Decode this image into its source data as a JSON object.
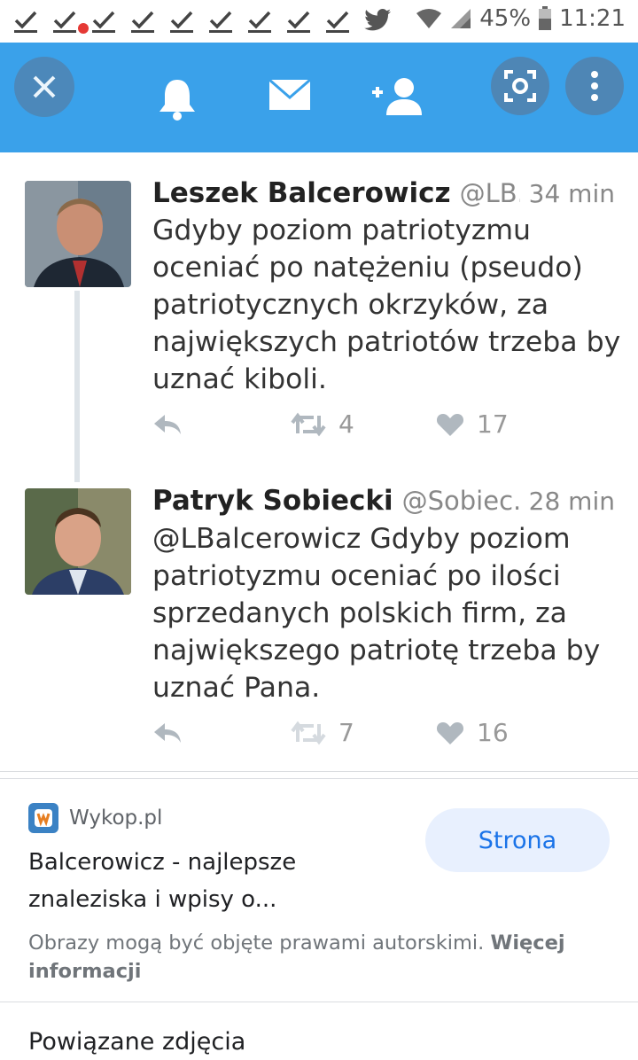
{
  "status_bar": {
    "battery_percent": "45%",
    "time": "11:21",
    "notification_icons": [
      "check-icon",
      "check-icon",
      "check-icon",
      "check-icon",
      "check-icon",
      "check-icon",
      "check-icon",
      "check-icon",
      "check-icon",
      "twitter-icon"
    ]
  },
  "toolbar": {
    "icons": [
      "close-icon",
      "notifications-bell-icon",
      "messages-envelope-icon",
      "add-user-icon",
      "lens-search-icon",
      "more-vert-icon"
    ],
    "background": "#3aa1ea"
  },
  "tweets": [
    {
      "name": "Leszek Balcerowicz",
      "handle": "@LB...",
      "time": "34 min",
      "text": "Gdyby poziom patriotyzmu oceniać po natężeniu (pseudo) patriotycznych okrzyków, za największych patriotów trzeba by uznać kiboli.",
      "retweets": "4",
      "likes": "17"
    },
    {
      "name": "Patryk Sobiecki",
      "handle": "@Sobiec...",
      "time": "28 min",
      "text": "@LBalcerowicz Gdyby poziom patriotyzmu oceniać po ilości sprzedanych polskich firm, za największego patriotę trzeba by uznać Pana.",
      "retweets": "7",
      "likes": "16"
    }
  ],
  "card": {
    "source": "Wykop.pl",
    "title": "Balcerowicz - najlepsze znaleziska i wpisy o...",
    "button_label": "Strona",
    "copyright_text": "Obrazy mogą być objęte prawami autorskimi. ",
    "more_info_label": "Więcej informacji",
    "related_heading": "Powiązane zdjęcia"
  },
  "colors": {
    "accent": "#1a73e8",
    "twitter_blue": "#3aa1ea"
  }
}
